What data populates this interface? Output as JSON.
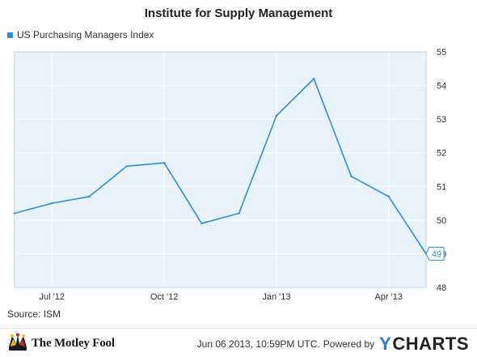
{
  "chart_data": {
    "type": "line",
    "title": "Institute for Supply Management",
    "x_ticks": [
      "Jul '12",
      "Oct '12",
      "Jan '13",
      "Apr '13"
    ],
    "x": [
      "Jun '12",
      "Jul '12",
      "Aug '12",
      "Sep '12",
      "Oct '12",
      "Nov '12",
      "Dec '12",
      "Jan '13",
      "Feb '13",
      "Mar '13",
      "Apr '13",
      "May '13"
    ],
    "series": [
      {
        "name": "US Purchasing Managers Index",
        "values": [
          50.2,
          50.5,
          50.7,
          51.6,
          51.7,
          49.9,
          50.2,
          53.1,
          54.2,
          51.3,
          50.7,
          49.0
        ],
        "color": "#2c8fdb"
      }
    ],
    "last_value_label": "49",
    "y_ticks": [
      48,
      49,
      50,
      51,
      52,
      53,
      54,
      55
    ],
    "ylim": [
      48,
      55
    ],
    "y_axis_side": "right",
    "grid": true,
    "legend": "top-left",
    "plot_background": "#eaf3fb"
  },
  "source": "Source: ISM",
  "brand": {
    "name": "The Motley Fool",
    "timestamp": "Jun 06 2013, 10:59PM UTC.",
    "powered_by": "Powered by",
    "ycharts_y": "Y",
    "ycharts_rest": "CHARTS"
  }
}
